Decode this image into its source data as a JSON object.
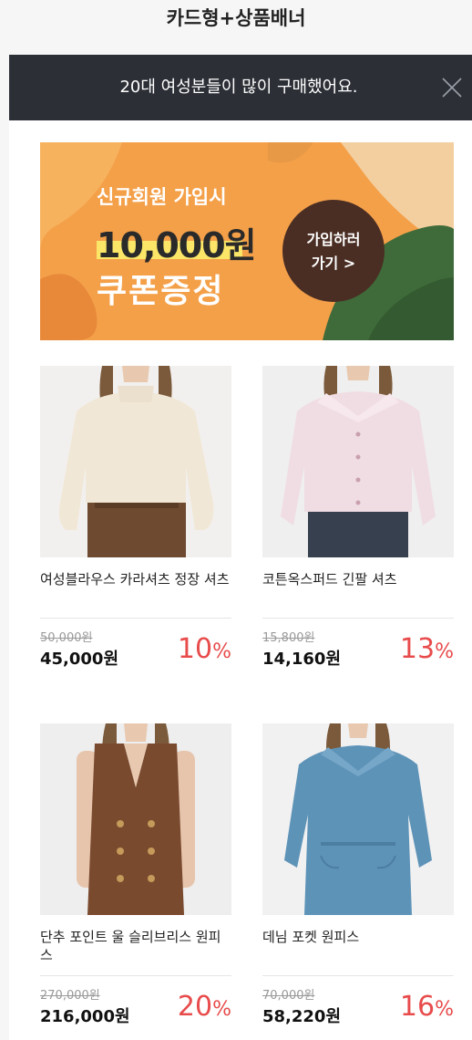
{
  "page": {
    "title": "카드형+상품배너"
  },
  "notice": {
    "text": "20대 여성분들이 많이 구매했어요.",
    "close_icon": "close-icon"
  },
  "banner": {
    "line1": "신규회원 가입시",
    "amount": "10,000원",
    "line3": "쿠폰증정",
    "cta_line1": "가입하러",
    "cta_line2": "가기 >",
    "colors": {
      "background": "#f4a049",
      "cta": "#4a2e24",
      "highlight": "#fbe668",
      "leaf": "#3f6b3a"
    }
  },
  "products": [
    {
      "name": "여성블라우스 카라셔츠 정장 셔츠",
      "original_price": "50,000원",
      "sale_price": "45,000원",
      "discount": "10",
      "unit": "%"
    },
    {
      "name": "코튼옥스퍼드 긴팔 셔츠",
      "original_price": "15,800원",
      "sale_price": "14,160원",
      "discount": "13",
      "unit": "%"
    },
    {
      "name": "단추 포인트 울 슬리브리스 원피스",
      "original_price": "270,000원",
      "sale_price": "216,000원",
      "discount": "20",
      "unit": "%"
    },
    {
      "name": "데님 포켓 원피스",
      "original_price": "70,000원",
      "sale_price": "58,220원",
      "discount": "16",
      "unit": "%"
    }
  ],
  "colors": {
    "discount": "#e84b4b",
    "notice_bg": "#2c2f36"
  }
}
